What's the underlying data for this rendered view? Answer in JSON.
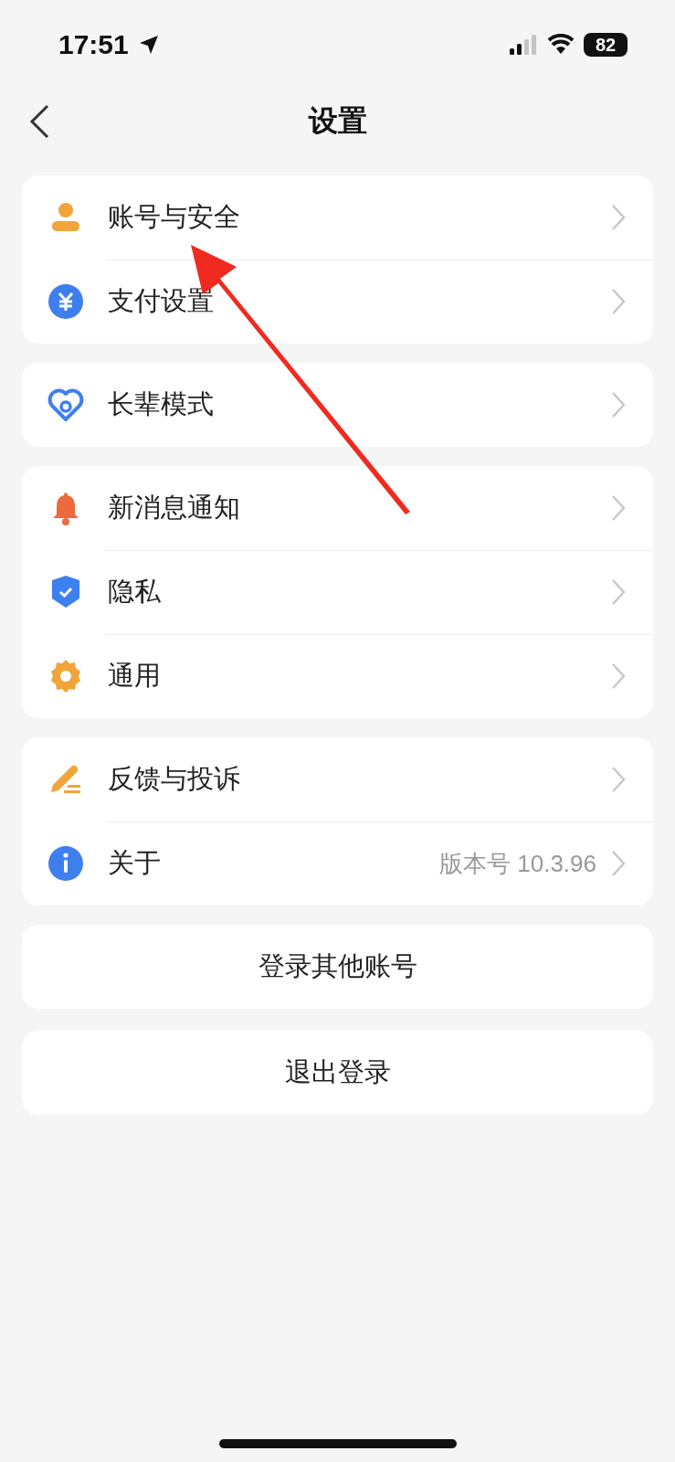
{
  "status_bar": {
    "time": "17:51",
    "battery": "82"
  },
  "nav": {
    "title": "设置"
  },
  "groups": [
    {
      "items": [
        {
          "label": "账号与安全"
        },
        {
          "label": "支付设置"
        }
      ]
    },
    {
      "items": [
        {
          "label": "长辈模式"
        }
      ]
    },
    {
      "items": [
        {
          "label": "新消息通知"
        },
        {
          "label": "隐私"
        },
        {
          "label": "通用"
        }
      ]
    },
    {
      "items": [
        {
          "label": "反馈与投诉"
        },
        {
          "label": "关于",
          "value": "版本号 10.3.96"
        }
      ]
    }
  ],
  "actions": [
    {
      "label": "登录其他账号"
    },
    {
      "label": "退出登录"
    }
  ]
}
